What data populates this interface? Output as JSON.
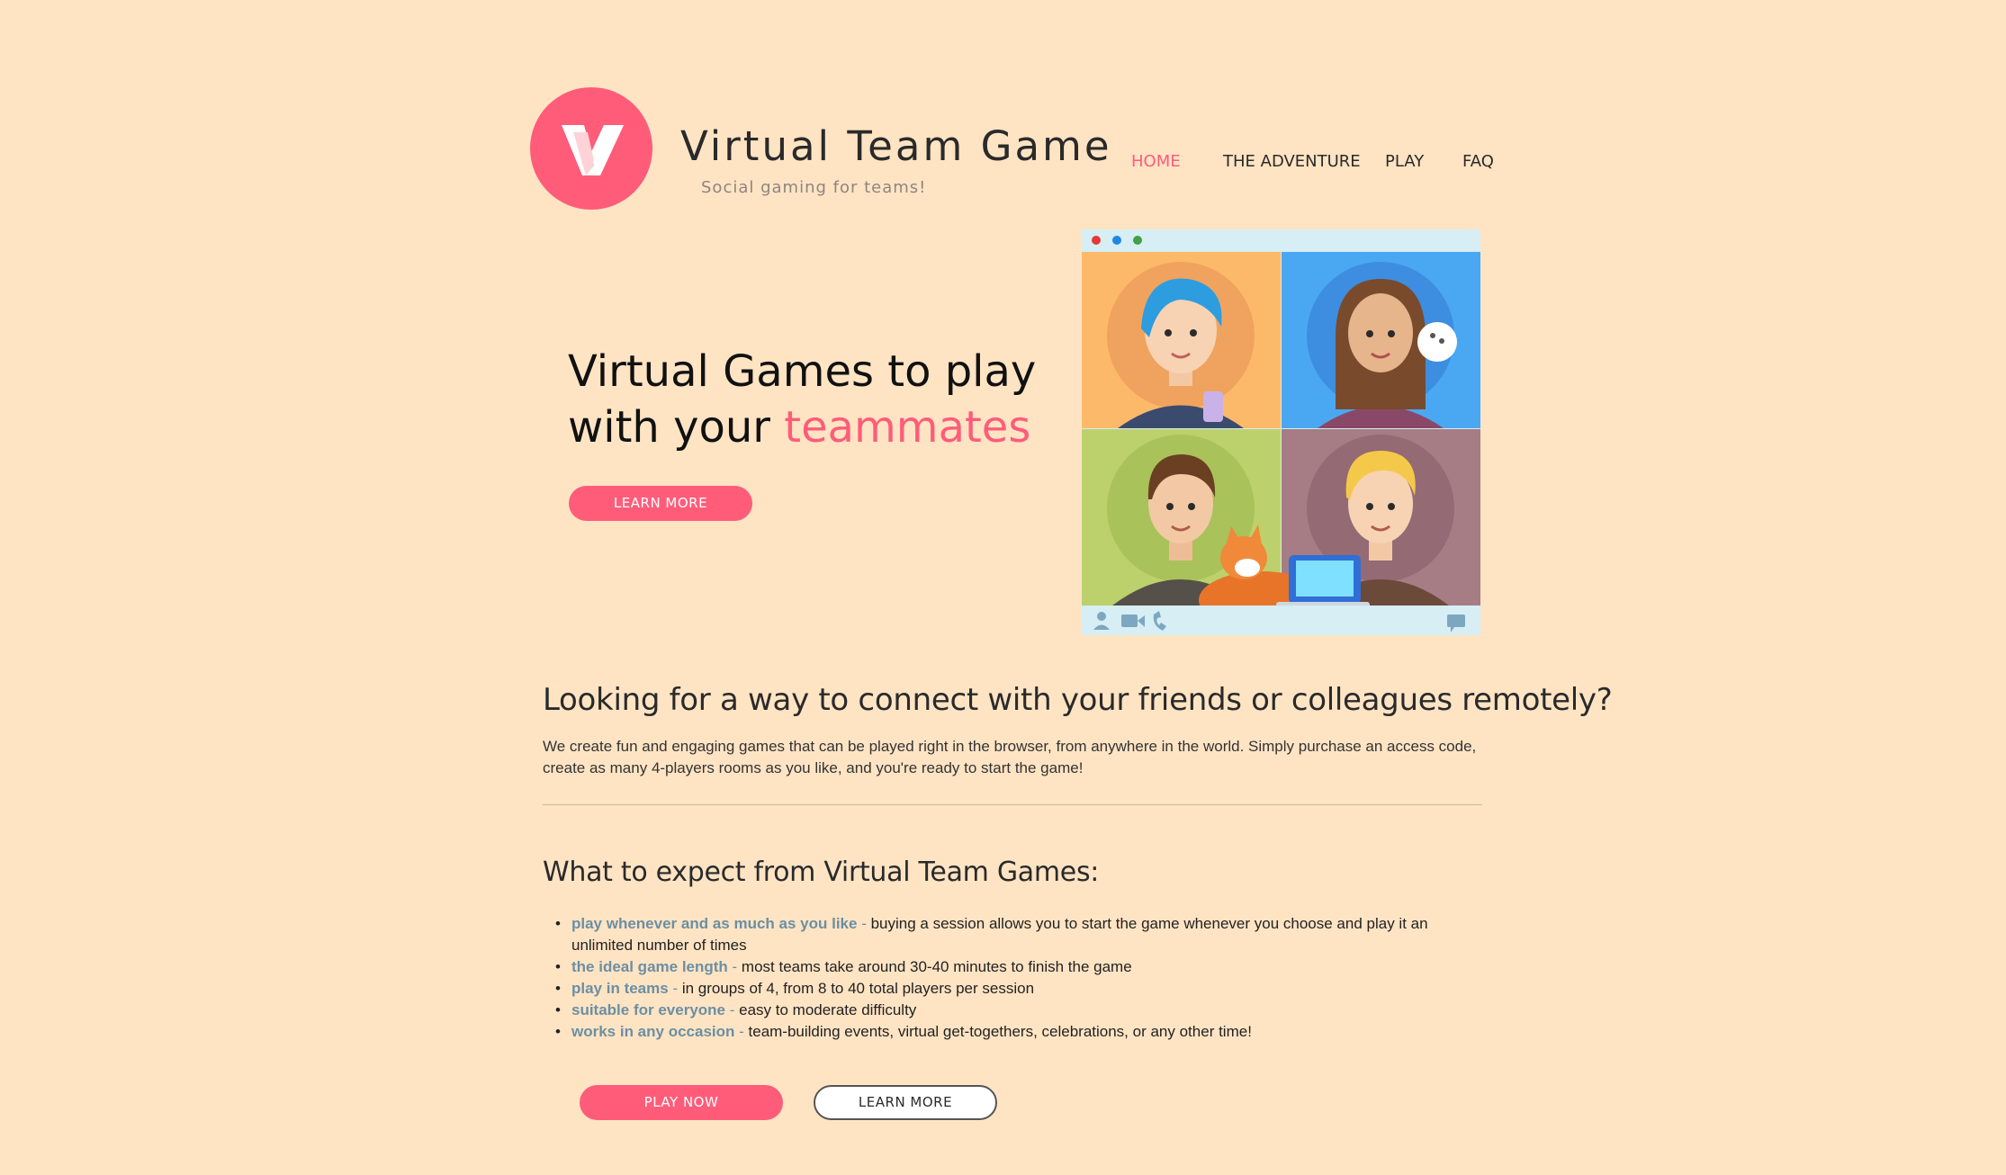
{
  "header": {
    "title": "Virtual Team Game",
    "tagline": "Social gaming for teams!",
    "logo_letter": "V"
  },
  "nav": {
    "items": [
      {
        "label": "HOME",
        "active": true
      },
      {
        "label": "THE ADVENTURE",
        "active": false
      },
      {
        "label": "PLAY",
        "active": false
      },
      {
        "label": "FAQ",
        "active": false
      }
    ]
  },
  "hero": {
    "line1": "Virtual Games to play",
    "line2_prefix": "with your ",
    "line2_accent": "teammates",
    "button_label": "LEARN MORE"
  },
  "intro": {
    "heading": "Looking for a way to connect with your friends or colleagues remotely?",
    "text": "We create fun and engaging games that can be played right in the browser, from anywhere in the world. Simply purchase an access code, create as many 4-players rooms as you like, and you're ready to start the game!"
  },
  "expect": {
    "heading": "What to expect from Virtual Team Games:",
    "items": [
      {
        "key": "play whenever and as much as you like",
        "desc": "buying a session allows you to start the game whenever you choose and play it an unlimited number of times"
      },
      {
        "key": "the ideal game length",
        "desc": "most teams take around 30-40 minutes to finish the game"
      },
      {
        "key": "play in teams",
        "desc": "in groups of 4, from 8 to 40 total players per session"
      },
      {
        "key": "suitable for everyone",
        "desc": "easy to moderate difficulty"
      },
      {
        "key": "works in any occasion",
        "desc": "team-building events, virtual get-togethers, celebrations, or any other time!"
      }
    ]
  },
  "actions": {
    "play_label": "PLAY NOW",
    "learn_label": "LEARN MORE"
  },
  "colors": {
    "background": "#ffe4c4",
    "accent": "#ff5c7a",
    "feature_key": "#6b8fa3"
  }
}
